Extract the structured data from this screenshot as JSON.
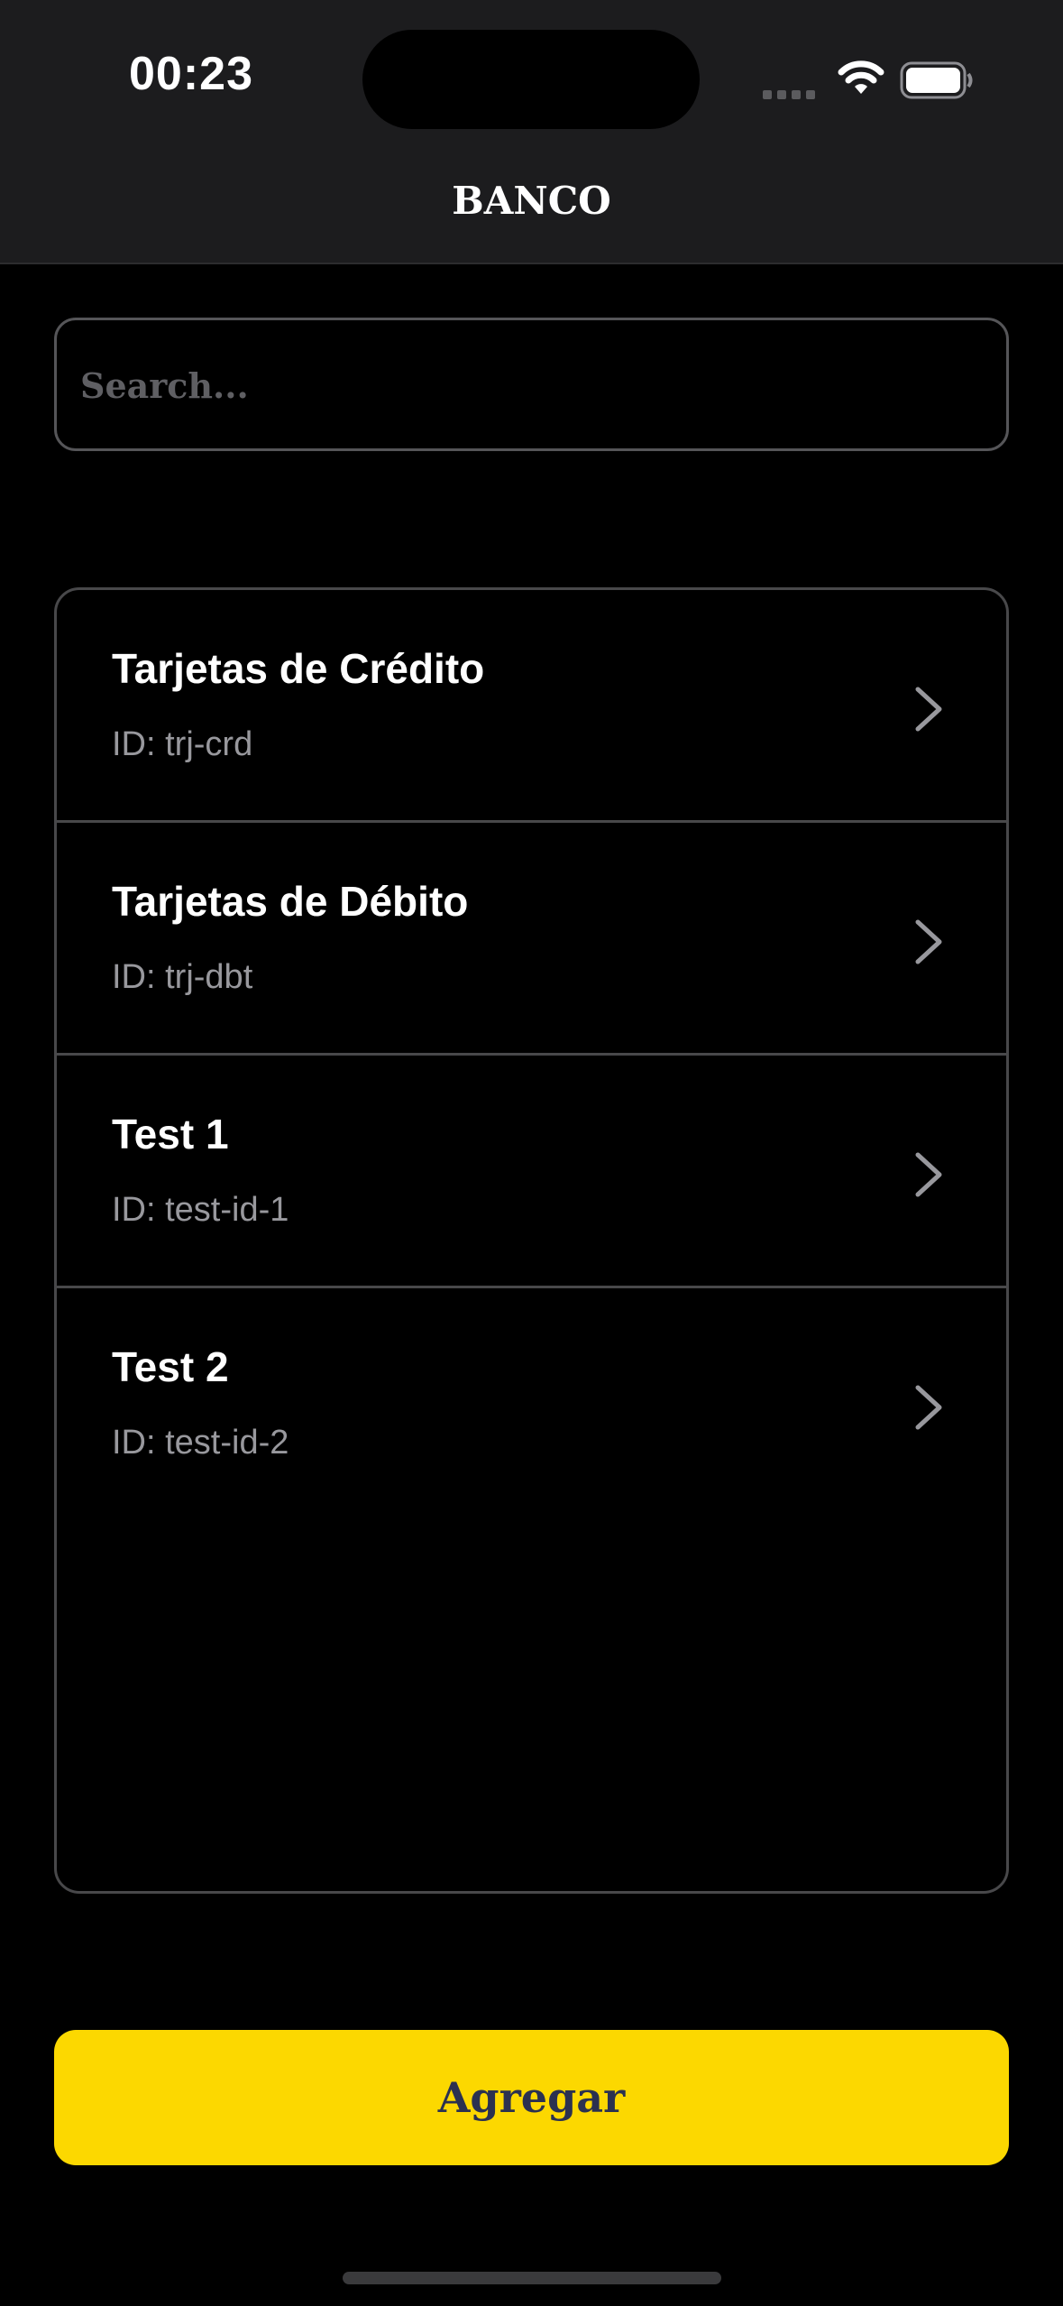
{
  "status_bar": {
    "time": "00:23",
    "icons": [
      "signal-icon",
      "wifi-icon",
      "battery-icon"
    ]
  },
  "header": {
    "title": "BANCO"
  },
  "search": {
    "value": "",
    "placeholder": "Search..."
  },
  "list": {
    "items": [
      {
        "title": "Tarjetas de Crédito",
        "id_text": "ID: trj-crd",
        "icon": "chevron-right-icon"
      },
      {
        "title": "Tarjetas de Débito",
        "id_text": "ID: trj-dbt",
        "icon": "chevron-right-icon"
      },
      {
        "title": "Test 1",
        "id_text": "ID: test-id-1",
        "icon": "chevron-right-icon"
      },
      {
        "title": "Test 2",
        "id_text": "ID: test-id-2",
        "icon": "chevron-right-icon"
      }
    ]
  },
  "footer": {
    "add_label": "Agregar"
  },
  "colors": {
    "accent": "#fcd800",
    "button_text": "#2b3150",
    "background": "#000000",
    "header_bg": "#1c1c1e",
    "secondary_text": "#98989d"
  }
}
